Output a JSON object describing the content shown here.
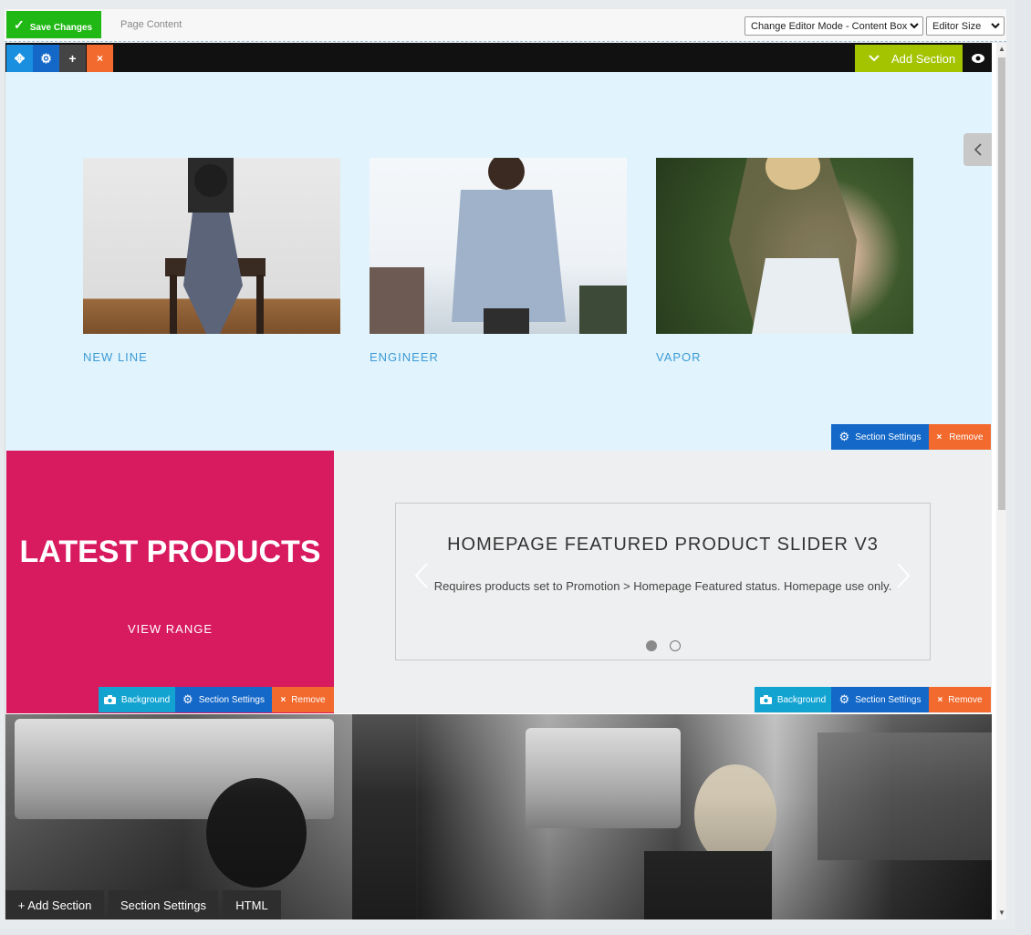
{
  "toolbar": {
    "save_label": "Save Changes",
    "page_content_label": "Page Content",
    "editor_mode_value": "Change Editor Mode - Content Box",
    "editor_size_value": "Editor Size"
  },
  "row_bar": {
    "add_section_label": "Add Section"
  },
  "section1": {
    "cards": [
      {
        "title": "NEW LINE"
      },
      {
        "title": "ENGINEER"
      },
      {
        "title": "VAPOR"
      }
    ],
    "section_settings_label": "Section Settings",
    "remove_label": "Remove"
  },
  "section2": {
    "promo_title": "LATEST PRODUCTS",
    "promo_link": "VIEW RANGE",
    "slider_title": "HOMEPAGE FEATURED PRODUCT SLIDER V3",
    "slider_desc": "Requires products set to Promotion > Homepage Featured status. Homepage use only.",
    "background_label": "Background",
    "section_settings_label": "Section Settings",
    "remove_label": "Remove"
  },
  "section3": {
    "add_section_label": "+ Add Section",
    "section_settings_label": "Section Settings",
    "html_label": "HTML"
  },
  "colors": {
    "save_green": "#1fb814",
    "add_section_green": "#a4c400",
    "settings_blue": "#1468c8",
    "remove_orange": "#f26a2e",
    "background_cyan": "#12a3d1",
    "promo_pink": "#d81a5f",
    "card_title_blue": "#3d9bd6"
  }
}
